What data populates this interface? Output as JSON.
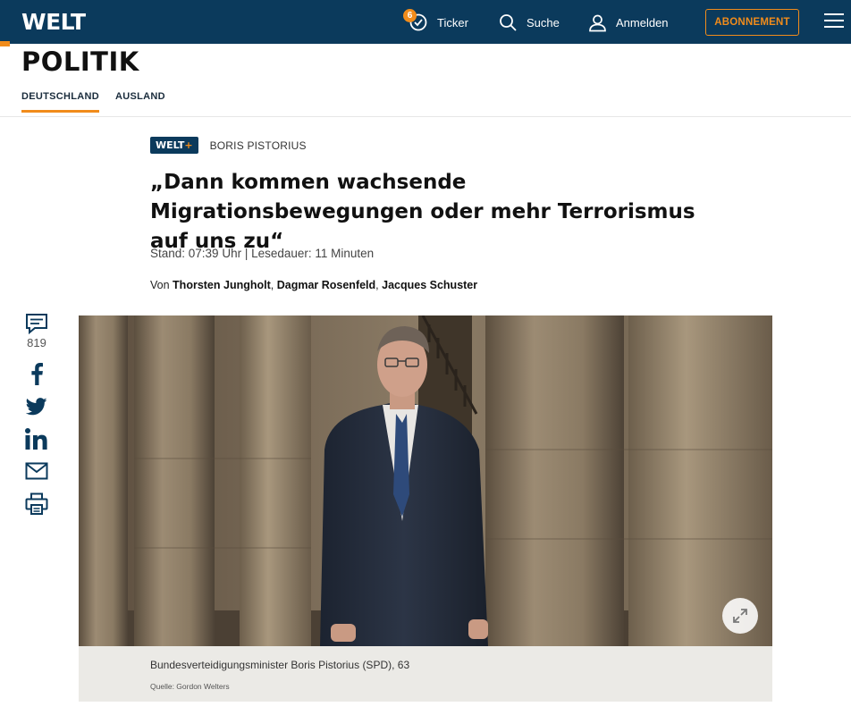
{
  "header": {
    "logo": "WELT",
    "ticker_badge": "6",
    "ticker_label": "Ticker",
    "search_label": "Suche",
    "login_label": "Anmelden",
    "subscribe_label": "ABONNEMENT",
    "accent_color": "#f18c1b",
    "brand_color": "#0b3a5c"
  },
  "section": {
    "title": "POLITIK",
    "tabs": [
      {
        "label": "DEUTSCHLAND",
        "active": true
      },
      {
        "label": "AUSLAND",
        "active": false
      }
    ]
  },
  "article": {
    "badge_text": "WELT",
    "badge_plus": "+",
    "topic": "BORIS PISTORIUS",
    "headline": "„Dann kommen wachsende Migrationsbewegungen oder mehr Terrorismus auf uns zu“",
    "meta": "Stand: 07:39 Uhr | Lesedauer: 11 Minuten",
    "authors_prefix": "Von",
    "authors": [
      "Thorsten Jungholt",
      "Dagmar Rosenfeld",
      "Jacques Schuster"
    ],
    "caption": "Bundesverteidigungsminister Boris Pistorius (SPD), 63",
    "credit": "Quelle: Gordon Welters"
  },
  "share": {
    "comment_count": "819",
    "icons": [
      "comment-icon",
      "facebook-icon",
      "twitter-icon",
      "linkedin-icon",
      "mail-icon",
      "print-icon"
    ]
  }
}
